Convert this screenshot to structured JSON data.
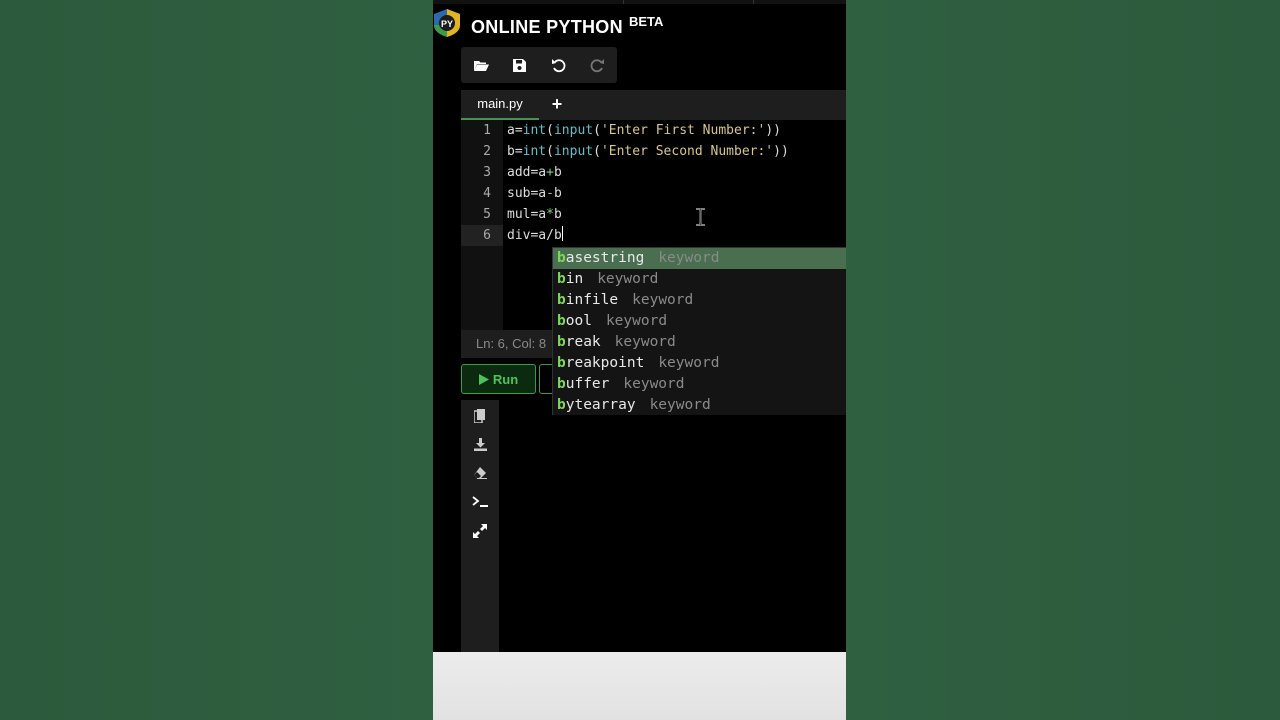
{
  "app": {
    "title": "ONLINE PYTHON",
    "badge": "BETA",
    "logo_text": "PY"
  },
  "toolbar": {
    "open_icon": "folder-open-icon",
    "save_icon": "save-icon",
    "undo_icon": "undo-icon",
    "redo_icon": "redo-icon"
  },
  "tabs": {
    "file": "main.py",
    "add": "+"
  },
  "editor": {
    "line_numbers": [
      "1",
      "2",
      "3",
      "4",
      "5",
      "6"
    ],
    "active_line": 6
  },
  "status": {
    "text": "Ln: 6,  Col: 8"
  },
  "actions": {
    "run_label": "Run"
  },
  "autocomplete": {
    "typed": "b",
    "items": [
      {
        "rest": "asestring",
        "meta": "keyword"
      },
      {
        "rest": "in",
        "meta": "keyword"
      },
      {
        "rest": "infile",
        "meta": "keyword"
      },
      {
        "rest": "ool",
        "meta": "keyword"
      },
      {
        "rest": "reak",
        "meta": "keyword"
      },
      {
        "rest": "reakpoint",
        "meta": "keyword"
      },
      {
        "rest": "uffer",
        "meta": "keyword"
      },
      {
        "rest": "ytearray",
        "meta": "keyword"
      }
    ]
  },
  "output_sidebar": {
    "icons": [
      "copy-icon",
      "download-icon",
      "eraser-icon",
      "terminal-icon",
      "expand-icon"
    ]
  },
  "colors": {
    "accent": "#3c9a4a",
    "background": "#2e5c3e"
  }
}
